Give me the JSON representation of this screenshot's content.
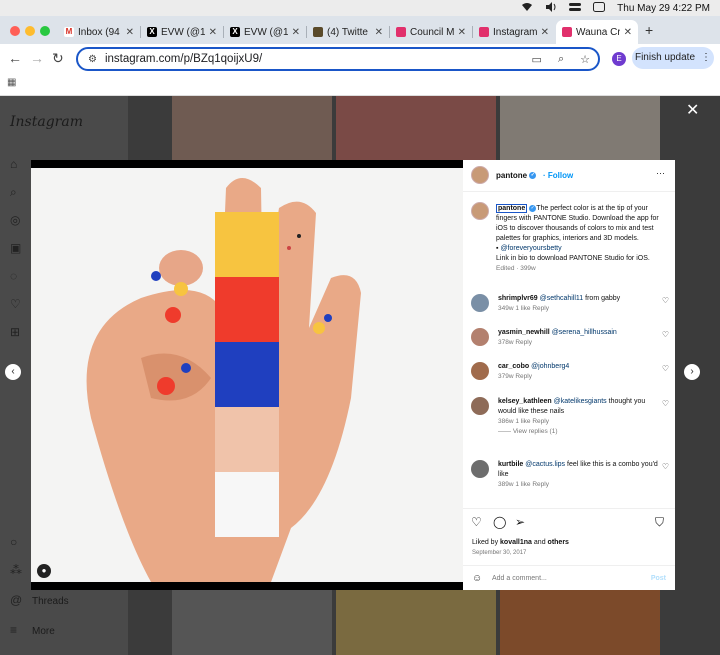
{
  "menubar": {
    "datetime": "Thu May 29  4:22 PM"
  },
  "tabs": [
    {
      "label": "Inbox (94",
      "icon": "gmail-icon",
      "color": "#d93025",
      "glyph": "M"
    },
    {
      "label": "EVW (@1",
      "icon": "x-icon",
      "color": "#000000",
      "glyph": "X"
    },
    {
      "label": "EVW (@1",
      "icon": "x-icon",
      "color": "#000000",
      "glyph": "X"
    },
    {
      "label": "(4) Twitte",
      "icon": "twitter-icon",
      "color": "#5a4a2a",
      "glyph": ""
    },
    {
      "label": "Council M",
      "icon": "instagram-icon",
      "color": "#e1306c",
      "glyph": ""
    },
    {
      "label": "Instagram",
      "icon": "instagram-icon",
      "color": "#e1306c",
      "glyph": ""
    },
    {
      "label": "Wauna Cr",
      "icon": "instagram-icon",
      "color": "#e1306c",
      "glyph": ""
    }
  ],
  "url": "instagram.com/p/BZq1qoijxU9/",
  "profile_initial": "E",
  "finish_update": "Finish update",
  "sidebar": {
    "logo": "Instagram",
    "threads": "Threads",
    "more": "More"
  },
  "post": {
    "handle": "pantone",
    "follow": "Follow",
    "caption_handle": "pantone",
    "caption_text": "The perfect color is at the tip of your fingers with PANTONE Studio. Download the app for iOS to discover thousands of colors to mix and test palettes for graphics, interiors and 3D models.",
    "credit_handle": "@foreveryoursbetty",
    "caption_tail": "Link in bio to download PANTONE Studio for iOS.",
    "edited": "Edited · 399w",
    "comments": [
      {
        "user": "shrimplvr69",
        "mention": "@sethcahill11",
        "text": "from gabby",
        "meta": "349w   1 like   Reply"
      },
      {
        "user": "yasmin_newhill",
        "mention": "@serena_hillhussain",
        "text": "",
        "meta": "378w   Reply"
      },
      {
        "user": "car_cobo",
        "mention": "@johnberg4",
        "text": "",
        "meta": "379w   Reply"
      },
      {
        "user": "kelsey_kathleen",
        "mention": "@katelikesgiants",
        "text": "thought you would like these nails",
        "meta": "386w   1 like   Reply"
      },
      {
        "user": "kurtbile",
        "mention": "@cactus.lips",
        "text": "feel like this is a combo you'd like",
        "meta": "389w   1 like   Reply"
      }
    ],
    "view_replies": "View replies (1)",
    "liked_by_prefix": "Liked by",
    "liked_by_user": "kovall1na",
    "liked_by_and": "and",
    "liked_by_others": "others",
    "date": "September 30, 2017",
    "add_comment": "Add a comment...",
    "post_label": "Post"
  },
  "swatches": [
    "#f7c440",
    "#ef3b2c",
    "#1f3fbf",
    "#f0c3aa",
    "#f7f7f7"
  ]
}
